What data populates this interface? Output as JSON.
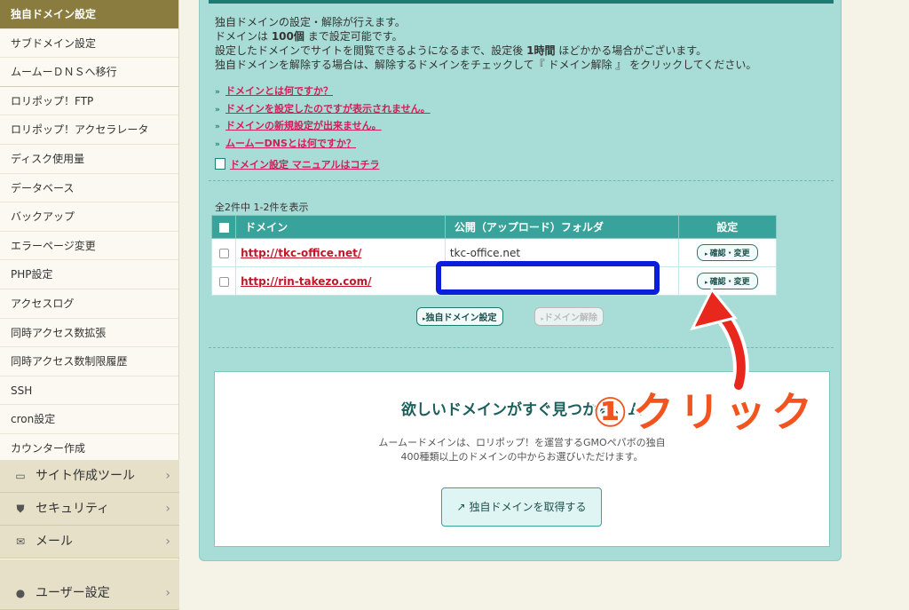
{
  "sidebar": {
    "items": [
      {
        "label": "独自ドメイン設定",
        "active": true
      },
      {
        "label": "サブドメイン設定"
      },
      {
        "label": "ムームーＤＮＳへ移行"
      },
      {
        "label": "ロリポップ！FTP"
      },
      {
        "label": "ロリポップ！アクセラレータ"
      },
      {
        "label": "ディスク使用量"
      },
      {
        "label": "データベース"
      },
      {
        "label": "バックアップ"
      },
      {
        "label": "エラーページ変更"
      },
      {
        "label": "PHP設定"
      },
      {
        "label": "アクセスログ"
      },
      {
        "label": "同時アクセス数拡張"
      },
      {
        "label": "同時アクセス数制限履歴"
      },
      {
        "label": "SSH"
      },
      {
        "label": "cron設定"
      },
      {
        "label": "カウンター作成"
      }
    ],
    "categories": [
      {
        "label": "サイト作成ツール",
        "icon": "laptop-icon"
      },
      {
        "label": "セキュリティ",
        "icon": "shield-icon"
      },
      {
        "label": "メール",
        "icon": "mail-icon"
      },
      {
        "label": "ユーザー設定",
        "icon": "user-icon"
      }
    ]
  },
  "main": {
    "intro": {
      "line1": "独自ドメインの設定・解除が行えます。",
      "line2_pre": "ドメインは ",
      "line2_bold": "100個",
      "line2_post": " まで設定可能です。",
      "line3_pre": "設定したドメインでサイトを閲覧できるようになるまで、設定後 ",
      "line3_bold": "1時間",
      "line3_post": " ほどかかる場合がございます。",
      "line4": "独自ドメインを解除する場合は、解除するドメインをチェックして『 ドメイン解除 』 をクリックしてください。"
    },
    "help_links": [
      "ドメインとは何ですか？",
      "ドメインを設定したのですが表示されません。",
      "ドメインの新規設定が出来ません。",
      "ムームーDNSとは何ですか？"
    ],
    "manual_link": "ドメイン設定 マニュアルはコチラ",
    "count_text": "全2件中 1-2件を表示",
    "table": {
      "headers": {
        "domain": "ドメイン",
        "folder": "公開（アップロード）フォルダ",
        "settings": "設定"
      },
      "rows": [
        {
          "domain": "http://tkc-office.net/",
          "folder": "tkc-office.net",
          "action": "確認・変更"
        },
        {
          "domain": "http://rin-takezo.com/",
          "folder": "",
          "action": "確認・変更"
        }
      ]
    },
    "buttons": {
      "set_domain": "独自ドメイン設定",
      "release_domain": "ドメイン解除"
    },
    "promo": {
      "title": "欲しいドメインがすぐ見つかる。ム",
      "desc_line1": "ムームードメインは、ロリポップ！を運営するGMOペパボの独自",
      "desc_line2": "400種類以上のドメインの中からお選びいただけます。",
      "button": "独自ドメインを取得する"
    }
  },
  "annotation": {
    "text": "①クリック",
    "color": "#f2541f",
    "arrow_color": "#e8281c"
  }
}
